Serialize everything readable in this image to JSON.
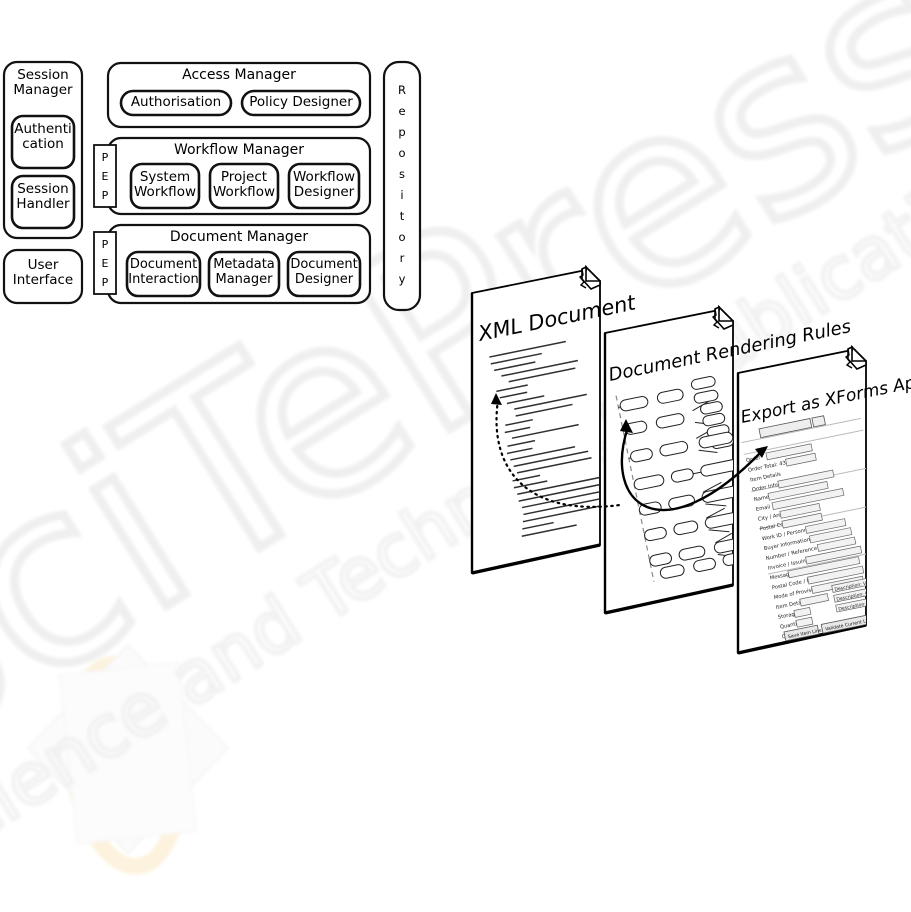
{
  "figure": {
    "kind": "architecture-and-process-diagram",
    "watermark": {
      "line1": "SciTePress",
      "line2": "Science and Technology Publications",
      "color": "#efefef",
      "logo_color": "#fdf5e0"
    }
  },
  "architecture": {
    "left_column": {
      "session_manager": {
        "label": "Session\nManager",
        "children": [
          {
            "label": "Authenti\ncation"
          },
          {
            "label": "Session\nHandler"
          }
        ]
      },
      "user_interface": {
        "label": "User\nInterface"
      }
    },
    "pep_gates": [
      {
        "label": "PEP",
        "letters": [
          "P",
          "E",
          "P"
        ]
      },
      {
        "label": "PEP",
        "letters": [
          "P",
          "E",
          "P"
        ]
      }
    ],
    "managers": [
      {
        "title": "Access Manager",
        "components": [
          {
            "label": "Authorisation"
          },
          {
            "label": "Policy Designer"
          }
        ]
      },
      {
        "title": "Workflow Manager",
        "components": [
          {
            "label": "System\nWorkflow"
          },
          {
            "label": "Project\nWorkflow"
          },
          {
            "label": "Workflow\nDesigner"
          }
        ]
      },
      {
        "title": "Document Manager",
        "components": [
          {
            "label": "Document\nInteraction"
          },
          {
            "label": "Metadata\nManager"
          },
          {
            "label": "Document\nDesigner"
          }
        ]
      }
    ],
    "repository": {
      "label": "Repository",
      "letters": [
        "R",
        "e",
        "p",
        "o",
        "s",
        "i",
        "t",
        "o",
        "r",
        "y"
      ]
    }
  },
  "process_flow": {
    "pages": [
      {
        "title": "XML Document",
        "body_kind": "xml-source-lines",
        "line_count": 26
      },
      {
        "title": "Document Rendering Rules",
        "body_kind": "rule-tree-graph",
        "node_count": 60
      },
      {
        "title": "Export as XForms Application",
        "body_kind": "xforms-form-preview",
        "field_count": 22
      }
    ],
    "arrows": [
      {
        "from": "XML Document",
        "to": "Document Rendering Rules",
        "style": "dotted"
      },
      {
        "from": "Document Rendering Rules",
        "to": "Export as XForms Application",
        "style": "solid"
      }
    ]
  }
}
